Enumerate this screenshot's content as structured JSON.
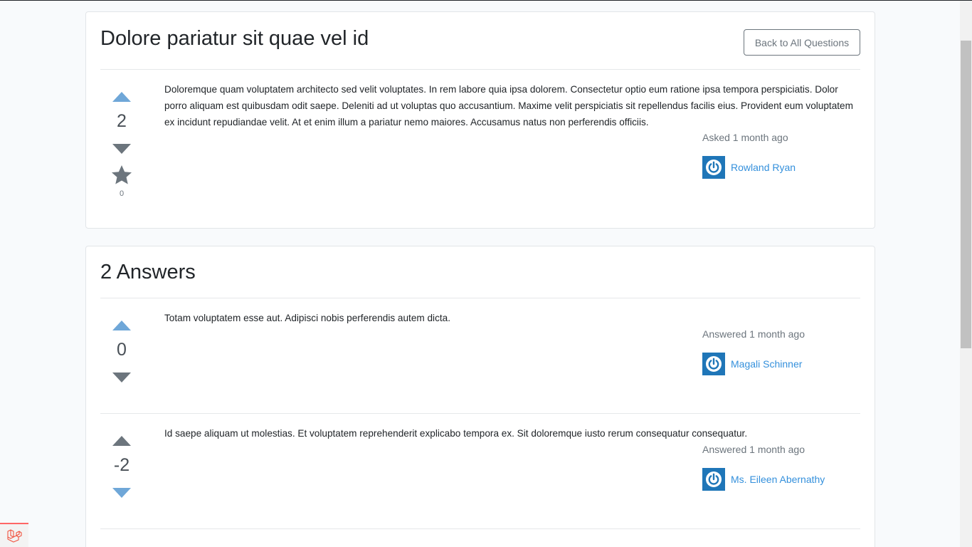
{
  "question": {
    "title": "Dolore pariatur sit quae vel id",
    "back_button_label": "Back to All Questions",
    "body": "Doloremque quam voluptatem architecto sed velit voluptates. In rem labore quia ipsa dolorem. Consectetur optio eum ratione ipsa tempora perspiciatis. Dolor porro aliquam est quibusdam odit saepe. Deleniti ad ut voluptas quo accusantium. Maxime velit perspiciatis sit repellendus facilis eius. Provident eum voluptatem ex incidunt repudiandae velit. At et enim illum a pariatur nemo maiores. Accusamus natus non perferendis officiis.",
    "votes": "2",
    "favorites": "0",
    "asked": "Asked 1 month ago",
    "author": "Rowland Ryan"
  },
  "answers": {
    "title": "2 Answers",
    "items": [
      {
        "body": "Totam voluptatem esse aut. Adipisci nobis perferendis autem dicta.",
        "votes": "0",
        "answered": "Answered 1 month ago",
        "author": "Magali Schinner",
        "up_color": "#6fa7d8",
        "down_color": "#6c757d"
      },
      {
        "body": "Id saepe aliquam ut molestias. Et voluptatem reprehenderit explicabo tempora ex. Sit doloremque iusto rerum consequatur consequatur.",
        "votes": "-2",
        "answered": "Answered 1 month ago",
        "author": "Ms. Eileen Abernathy",
        "up_color": "#6c757d",
        "down_color": "#6fa7d8"
      }
    ]
  },
  "icons": {
    "vote_up": "caret-up-icon",
    "vote_down": "caret-down-icon",
    "favorite": "star-icon",
    "avatar": "power-avatar-icon",
    "debug": "laravel-icon"
  },
  "colors": {
    "link": "#3490dc",
    "vote_active": "#6fa7d8",
    "vote_inactive": "#6c757d",
    "avatar_bg": "#1f76b8"
  }
}
